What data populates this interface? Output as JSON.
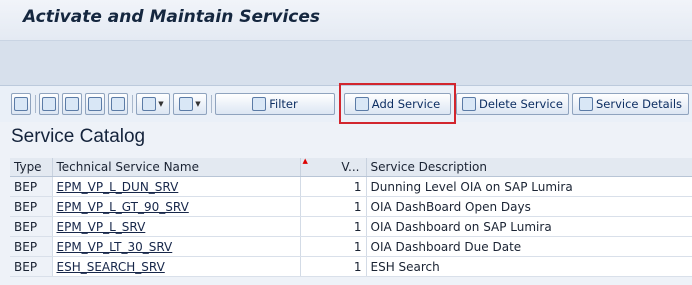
{
  "window": {
    "title": "Activate and Maintain Services"
  },
  "toolbar": {
    "filter_label": "Filter",
    "add_service_label": "Add Service",
    "delete_service_label": "Delete Service",
    "service_details_label": "Service Details"
  },
  "catalog": {
    "title": "Service Catalog",
    "columns": {
      "type": "Type",
      "technical_name": "Technical Service Name",
      "version": "V...",
      "description": "Service Description"
    },
    "rows": [
      {
        "type": "BEP",
        "name": "EPM_VP_L_DUN_SRV",
        "version": "1",
        "description": "Dunning Level OIA on SAP Lumira"
      },
      {
        "type": "BEP",
        "name": "EPM_VP_L_GT_90_SRV",
        "version": "1",
        "description": "OIA DashBoard Open Days"
      },
      {
        "type": "BEP",
        "name": "EPM_VP_L_SRV",
        "version": "1",
        "description": "OIA Dashboard on SAP Lumira"
      },
      {
        "type": "BEP",
        "name": "EPM_VP_LT_30_SRV",
        "version": "1",
        "description": "OIA Dashboard Due Date"
      },
      {
        "type": "BEP",
        "name": "ESH_SEARCH_SRV",
        "version": "1",
        "description": "ESH Search"
      }
    ]
  },
  "highlight_color": "#d2262e"
}
